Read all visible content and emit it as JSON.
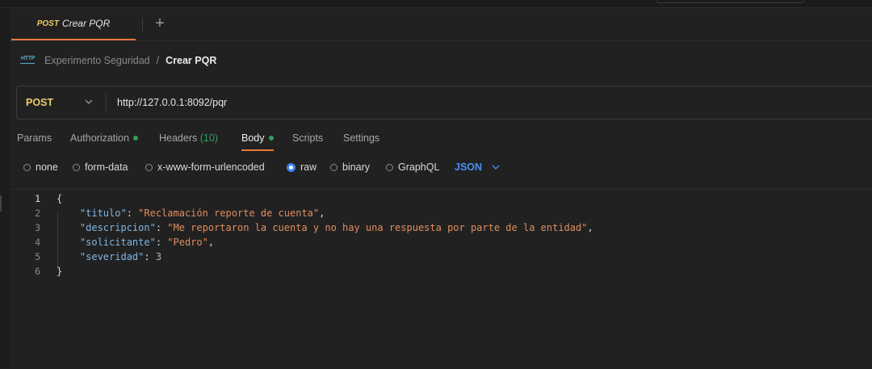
{
  "tab": {
    "method": "POST",
    "title": "Crear PQR",
    "add_label": "+"
  },
  "breadcrumb": {
    "icon_text": "HTTP",
    "collection": "Experimento Seguridad",
    "separator": "/",
    "current": "Crear PQR"
  },
  "request": {
    "method": "POST",
    "url": "http://127.0.0.1:8092/pqr"
  },
  "request_tabs": [
    {
      "label": "Params",
      "count": ""
    },
    {
      "label": "Authorization",
      "count": ""
    },
    {
      "label": "Headers",
      "count": "(10)"
    },
    {
      "label": "Body",
      "count": ""
    },
    {
      "label": "Scripts",
      "count": ""
    },
    {
      "label": "Settings",
      "count": ""
    }
  ],
  "body_types": [
    "none",
    "form-data",
    "x-www-form-urlencoded",
    "raw",
    "binary",
    "GraphQL"
  ],
  "body_type_selected": "raw",
  "format": "JSON",
  "editor": {
    "line_numbers": [
      "1",
      "2",
      "3",
      "4",
      "5",
      "6"
    ],
    "open_brace": "{",
    "close_brace": "}",
    "fields": [
      {
        "key": "\"titulo\"",
        "value": "\"Reclamación reporte de cuenta\"",
        "comma": ","
      },
      {
        "key": "\"descripcion\"",
        "value": "\"Me reportaron la cuenta y no hay una respuesta por parte de la entidad\"",
        "comma": ","
      },
      {
        "key": "\"solicitante\"",
        "value": "\"Pedro\"",
        "comma": ","
      },
      {
        "key": "\"severidad\"",
        "value": "3",
        "comma": ""
      }
    ]
  },
  "colors": {
    "accent": "#e8793a",
    "method": "#eccc68",
    "indicator": "#2ea05a",
    "link": "#4a8ff7"
  }
}
